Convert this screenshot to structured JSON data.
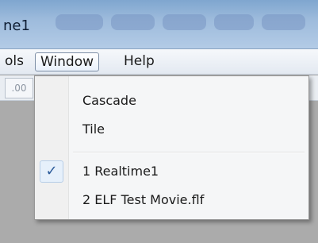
{
  "window": {
    "title_fragment": "ne1"
  },
  "menubar": {
    "items": [
      {
        "label": "ols"
      },
      {
        "label": "Window"
      },
      {
        "label": "Help"
      }
    ]
  },
  "toolbar": {
    "button_fragment": ".00"
  },
  "window_menu": {
    "items": [
      {
        "label": "Cascade",
        "checked": false
      },
      {
        "label": "Tile",
        "checked": false
      },
      {
        "label": "1 Realtime1",
        "checked": true
      },
      {
        "label": "2 ELF Test Movie.flf",
        "checked": false
      }
    ],
    "check_glyph": "✓"
  },
  "colors": {
    "titlebar": "#9dbbdc",
    "menu_background": "#f5f6f7",
    "workspace": "#ababab",
    "check_highlight": "#e6f0fb"
  }
}
